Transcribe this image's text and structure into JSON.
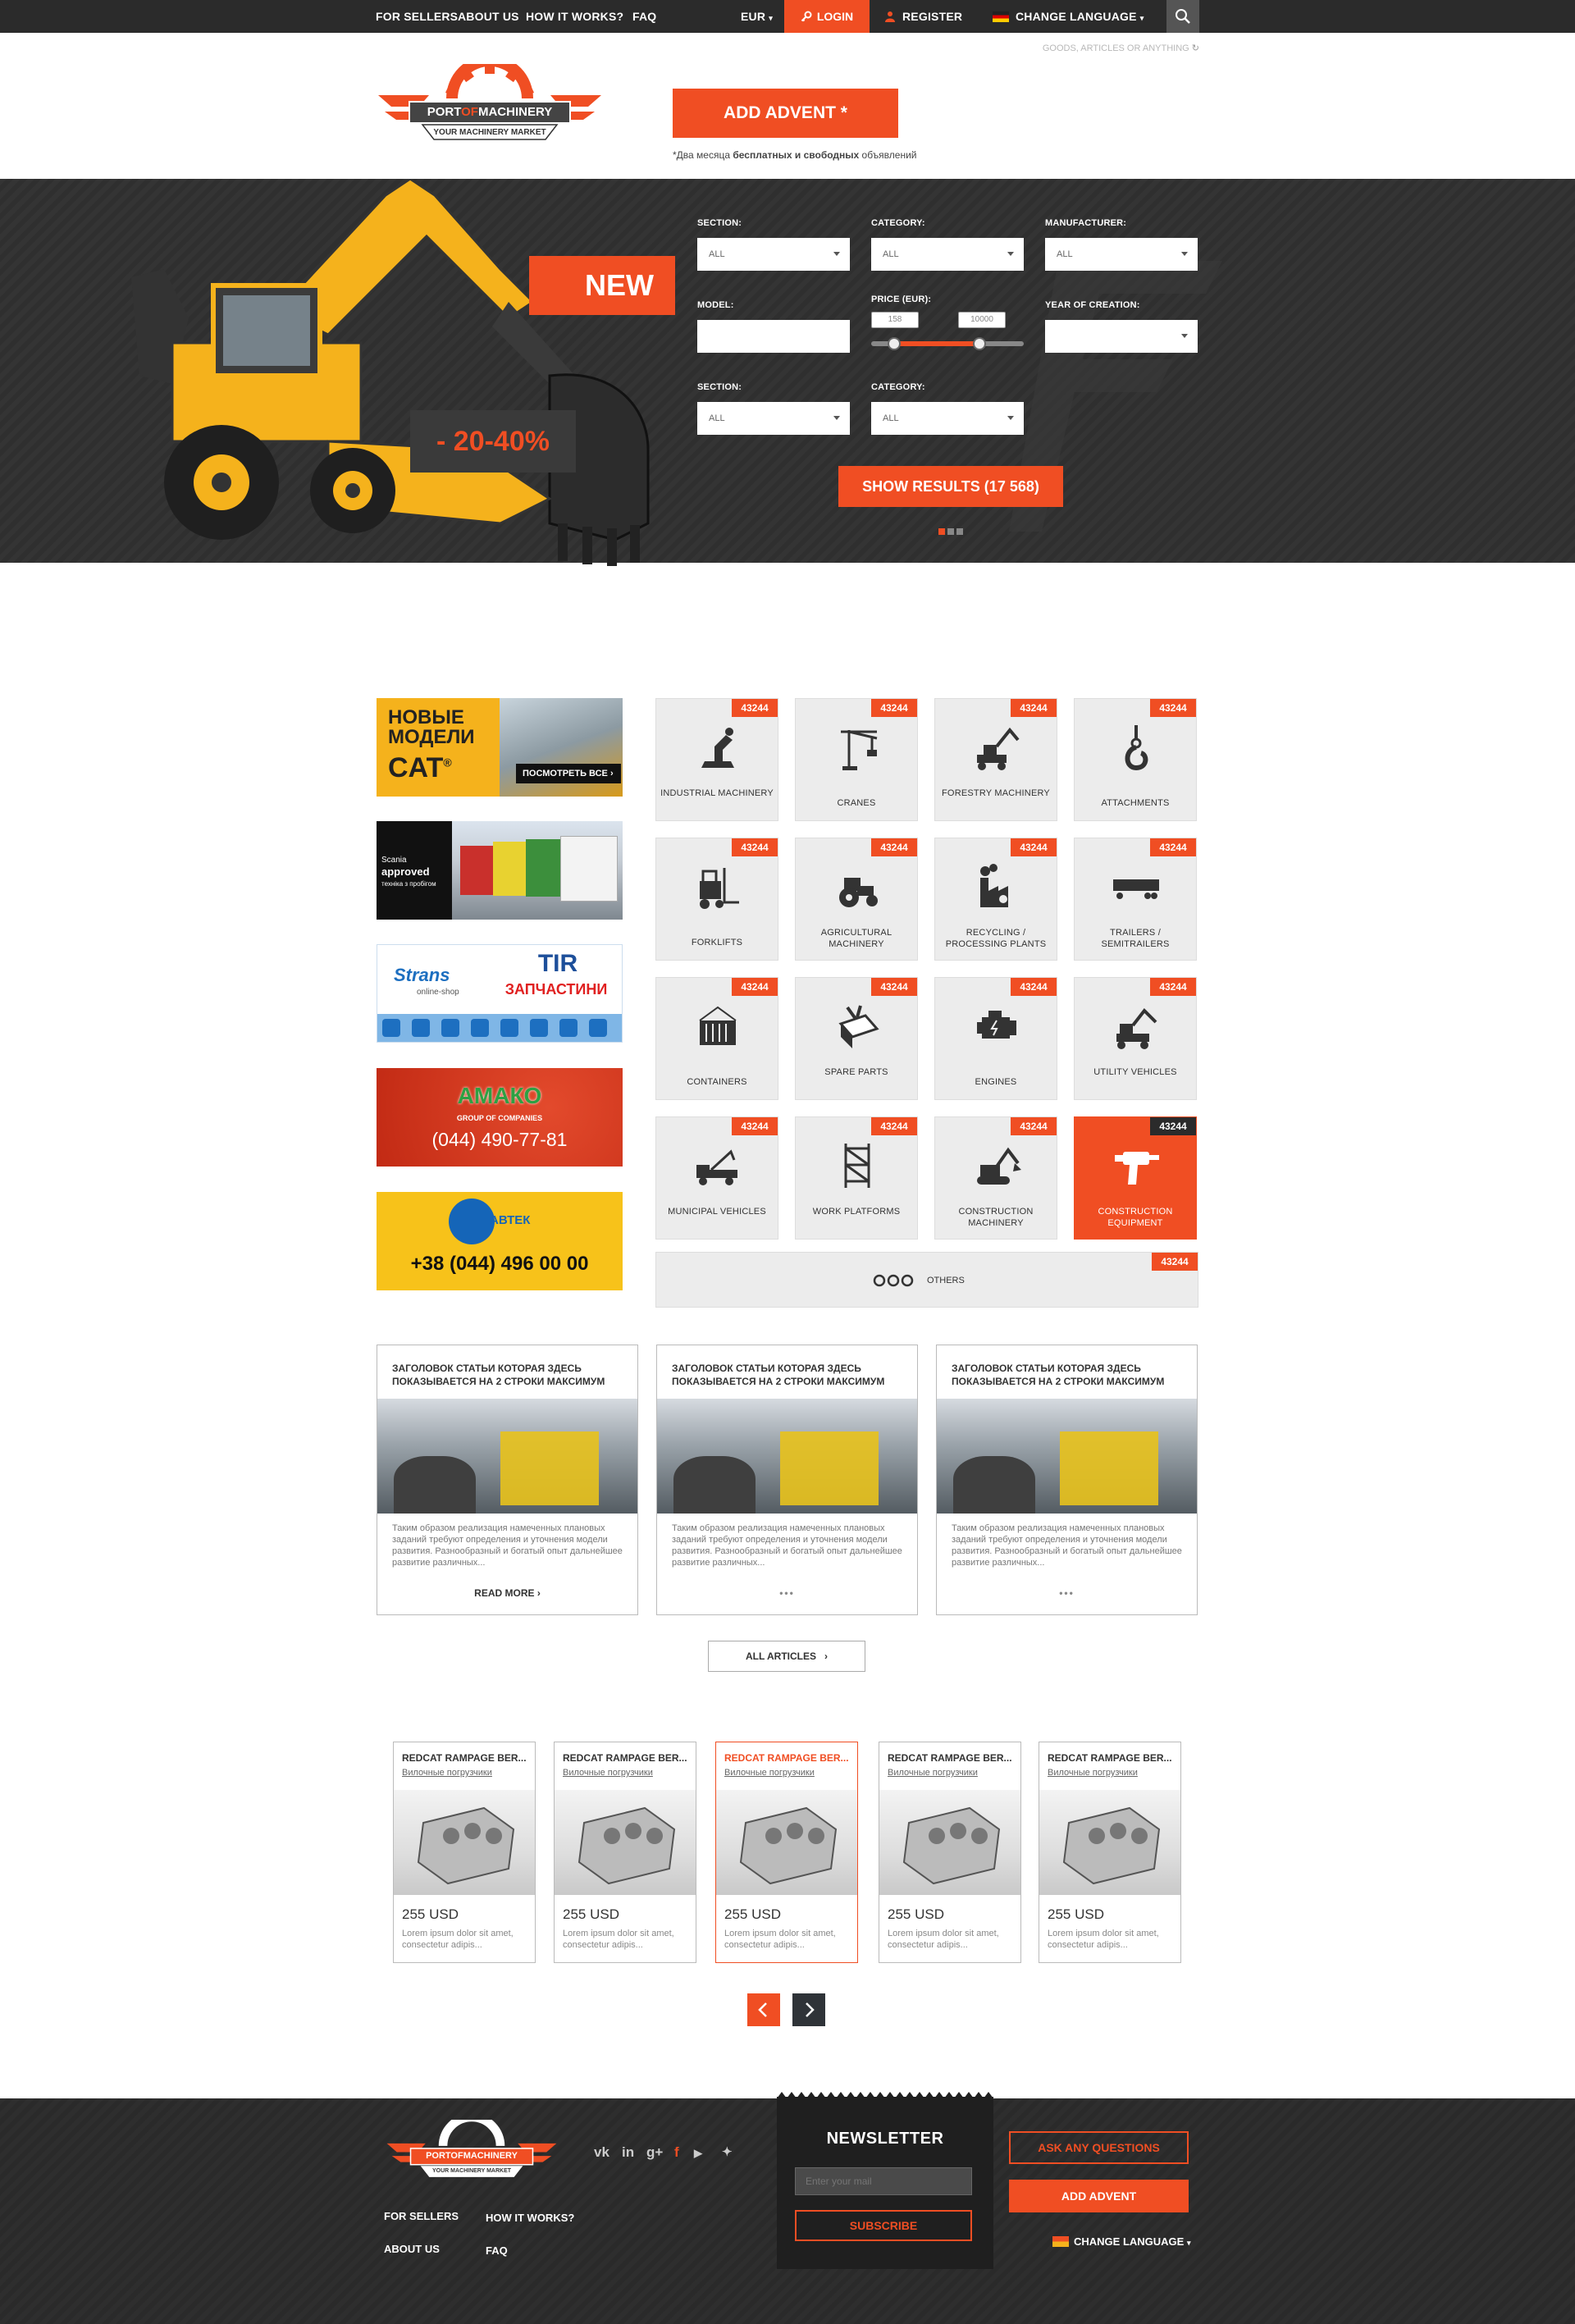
{
  "topbar": {
    "links": [
      "FOR SELLERS",
      "ABOUT US",
      "HOW IT WORKS?",
      "FAQ"
    ],
    "currency": "EUR",
    "login": "LOGIN",
    "register": "REGISTER",
    "language": "CHANGE LANGUAGE"
  },
  "header": {
    "logo_name_a": "PORT",
    "logo_name_b": "OF",
    "logo_name_c": "MACHINERY",
    "logo_tagline": "YOUR MACHINERY MARKET",
    "search_placeholder": "GOODS, ARTICLES OR ANYTHING",
    "add_advent": "ADD ADVENT *",
    "note_a": "*Два месяца ",
    "note_b": "бесплатных и свободных",
    "note_c": " объявлений"
  },
  "hero": {
    "new_badge": "NEW",
    "discount": "- 20-40%",
    "filters": {
      "section_label": "SECTION:",
      "section_value": "ALL",
      "category_label": "CATEGORY:",
      "category_value": "ALL",
      "manufacturer_label": "MANUFACTURER:",
      "manufacturer_value": "ALL",
      "model_label": "MODEL:",
      "model_value": "",
      "price_label": "PRICE (EUR):",
      "price_min": "158",
      "price_max": "10000",
      "year_label": "YEAR OF CREATION:",
      "year_value": "",
      "section2_label": "SECTION:",
      "section2_value": "ALL",
      "category2_label": "CATEGORY:",
      "category2_value": "ALL"
    },
    "show_results": "SHOW RESULTS (17 568)",
    "slides_total": 3,
    "slide_active": 1
  },
  "banners": {
    "cat_title": "НОВЫЕ МОДЕЛИ",
    "cat_brand": "CAT",
    "cat_cta": "ПОСМОТРЕТЬ ВСЕ",
    "scania_a": "Scania",
    "scania_b": "approved",
    "scania_c": "техніка з пробігом",
    "strans_logo": "Strans",
    "strans_sub": "online-shop",
    "tir_a": "TIR",
    "tir_b": "ЗАПЧАСТИНИ",
    "amako": "АМАКО",
    "amako_sub": "GROUP OF COMPANIES",
    "amako_phone": "(044) 490-77-81",
    "avtek": "АВТЕК",
    "avtek_phone": "+38 (044) 496 00 00"
  },
  "categories": [
    {
      "label": "INDUSTRIAL MACHINERY",
      "count": "43244",
      "icon": "robot-arm-icon"
    },
    {
      "label": "CRANES",
      "count": "43244",
      "icon": "crane-icon"
    },
    {
      "label": "FORESTRY MACHINERY",
      "count": "43244",
      "icon": "forestry-icon"
    },
    {
      "label": "ATTACHMENTS",
      "count": "43244",
      "icon": "hook-icon"
    },
    {
      "label": "FORKLIFTS",
      "count": "43244",
      "icon": "forklift-icon"
    },
    {
      "label": "AGRICULTURAL MACHINERY",
      "count": "43244",
      "icon": "tractor-icon"
    },
    {
      "label": "RECYCLING / PROCESSING PLANTS",
      "count": "43244",
      "icon": "factory-icon"
    },
    {
      "label": "TRAILERS / SEMITRAILERS",
      "count": "43244",
      "icon": "trailer-icon"
    },
    {
      "label": "CONTAINERS",
      "count": "43244",
      "icon": "container-icon"
    },
    {
      "label": "SPARE PARTS",
      "count": "43244",
      "icon": "toolbox-icon"
    },
    {
      "label": "ENGINES",
      "count": "43244",
      "icon": "engine-icon"
    },
    {
      "label": "UTILITY VEHICLES",
      "count": "43244",
      "icon": "utility-vehicle-icon"
    },
    {
      "label": "MUNICIPAL VEHICLES",
      "count": "43244",
      "icon": "tow-truck-icon"
    },
    {
      "label": "WORK PLATFORMS",
      "count": "43244",
      "icon": "scaffold-icon"
    },
    {
      "label": "CONSTRUCTION MACHINERY",
      "count": "43244",
      "icon": "excavator-icon"
    },
    {
      "label": "CONSTRUCTION EQUIPMENT",
      "count": "43244",
      "icon": "drill-icon"
    }
  ],
  "others": {
    "label": "OTHERS",
    "count": "43244"
  },
  "articles": [
    {
      "title": "ЗАГОЛОВОК СТАТЬИ КОТОРАЯ ЗДЕСЬ ПОКАЗЫВАЕТСЯ НА 2 СТРОКИ МАКСИМУМ",
      "text": "Таким образом реализация намеченных плановых заданий требуют определения и уточнения модели развития. Разнообразный и богатый опыт дальнейшее развитие различных...",
      "more": "READ MORE"
    },
    {
      "title": "ЗАГОЛОВОК СТАТЬИ КОТОРАЯ ЗДЕСЬ ПОКАЗЫВАЕТСЯ НА 2 СТРОКИ МАКСИМУМ",
      "text": "Таким образом реализация намеченных плановых заданий требуют определения и уточнения модели развития. Разнообразный и богатый опыт дальнейшее развитие различных...",
      "more": "•••"
    },
    {
      "title": "ЗАГОЛОВОК СТАТЬИ КОТОРАЯ ЗДЕСЬ ПОКАЗЫВАЕТСЯ НА 2 СТРОКИ МАКСИМУМ",
      "text": "Таким образом реализация намеченных плановых заданий требуют определения и уточнения модели развития. Разнообразный и богатый опыт дальнейшее развитие различных...",
      "more": "•••"
    }
  ],
  "all_articles": "ALL ARTICLES",
  "products": [
    {
      "title": "REDCAT RAMPAGE BER...",
      "sub": "Вилочные погрузчики",
      "price": "255 USD",
      "desc": "Lorem ipsum dolor sit amet, consectetur adipis..."
    },
    {
      "title": "REDCAT RAMPAGE BER...",
      "sub": "Вилочные погрузчики",
      "price": "255 USD",
      "desc": "Lorem ipsum dolor sit amet, consectetur adipis..."
    },
    {
      "title": "REDCAT RAMPAGE BER...",
      "sub": "Вилочные погрузчики",
      "price": "255 USD",
      "desc": "Lorem ipsum dolor sit amet, consectetur adipis..."
    },
    {
      "title": "REDCAT RAMPAGE BER...",
      "sub": "Вилочные погрузчики",
      "price": "255 USD",
      "desc": "Lorem ipsum dolor sit amet, consectetur adipis..."
    },
    {
      "title": "REDCAT RAMPAGE BER...",
      "sub": "Вилочные погрузчики",
      "price": "255 USD",
      "desc": "Lorem ipsum dolor sit amet, consectetur adipis..."
    }
  ],
  "footer": {
    "links": [
      "FOR SELLERS",
      "HOW IT WORKS?",
      "ABOUT US",
      "FAQ"
    ],
    "social_icons": [
      "vk-icon",
      "linkedin-icon",
      "google-plus-icon",
      "facebook-icon",
      "youtube-icon",
      "twitter-icon"
    ],
    "newsletter_title": "NEWSLETTER",
    "newsletter_placeholder": "Enter your mail",
    "subscribe": "SUBSCRIBE",
    "ask": "ASK ANY QUESTIONS",
    "add_advent": "ADD ADVENT",
    "language": "CHANGE LANGUAGE"
  },
  "colors": {
    "accent": "#f04e23",
    "dark": "#2b2b2b"
  }
}
